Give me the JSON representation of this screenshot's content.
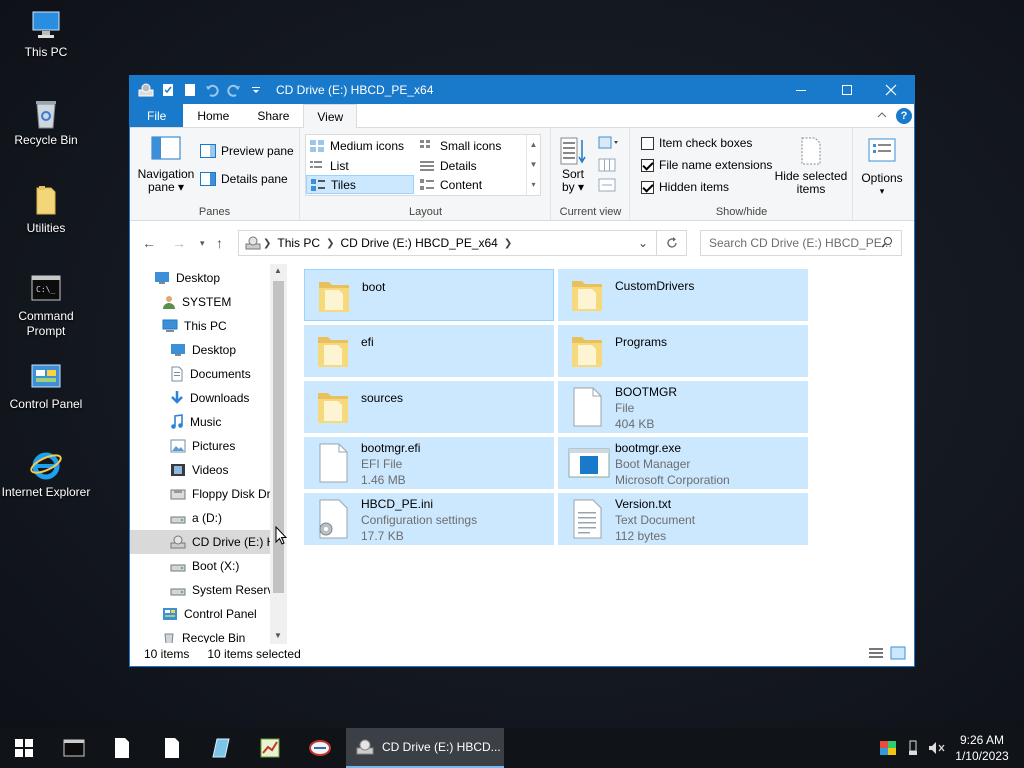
{
  "desktop": {
    "icons": [
      {
        "label": "This PC",
        "icon": "computer-icon"
      },
      {
        "label": "Recycle Bin",
        "icon": "recycle-bin-icon"
      },
      {
        "label": "Utilities",
        "icon": "folder-icon"
      },
      {
        "label": "Command Prompt",
        "icon": "command-prompt-icon"
      },
      {
        "label": "Control Panel",
        "icon": "control-panel-icon"
      },
      {
        "label": "Internet Explorer",
        "icon": "internet-explorer-icon"
      }
    ]
  },
  "window": {
    "title": "CD Drive (E:) HBCD_PE_x64",
    "ribbon_tabs": [
      "File",
      "Home",
      "Share",
      "View"
    ],
    "active_tab": "View",
    "ribbon": {
      "panes": {
        "navigation_pane_line1": "Navigation",
        "navigation_pane_line2": "pane",
        "preview_pane": "Preview pane",
        "details_pane": "Details pane",
        "label": "Panes"
      },
      "layout": {
        "options": [
          "Medium icons",
          "Small icons",
          "List",
          "Details",
          "Tiles",
          "Content"
        ],
        "selected": "Tiles",
        "label": "Layout"
      },
      "current_view": {
        "sort_line1": "Sort",
        "sort_line2": "by",
        "label": "Current view"
      },
      "show_hide": {
        "item_check_boxes": "Item check boxes",
        "file_name_extensions": "File name extensions",
        "hidden_items": "Hidden items",
        "item_check_boxes_checked": false,
        "file_name_extensions_checked": true,
        "hidden_items_checked": true,
        "hide_selected_line1": "Hide selected",
        "hide_selected_line2": "items",
        "label": "Show/hide"
      },
      "options_label": "Options"
    },
    "address": {
      "crumbs": [
        "This PC",
        "CD Drive (E:) HBCD_PE_x64"
      ],
      "search_placeholder": "Search CD Drive (E:) HBCD_PE..."
    },
    "nav_pane": [
      {
        "label": "Desktop",
        "icon": "desktop-icon"
      },
      {
        "label": "SYSTEM",
        "icon": "user-icon"
      },
      {
        "label": "This PC",
        "icon": "computer-icon"
      },
      {
        "label": "Desktop",
        "icon": "desktop-icon"
      },
      {
        "label": "Documents",
        "icon": "documents-icon"
      },
      {
        "label": "Downloads",
        "icon": "downloads-icon"
      },
      {
        "label": "Music",
        "icon": "music-icon"
      },
      {
        "label": "Pictures",
        "icon": "pictures-icon"
      },
      {
        "label": "Videos",
        "icon": "videos-icon"
      },
      {
        "label": "Floppy Disk Dri",
        "icon": "floppy-icon"
      },
      {
        "label": "a (D:)",
        "icon": "drive-icon"
      },
      {
        "label": "CD Drive (E:) H",
        "icon": "cd-drive-icon"
      },
      {
        "label": "Boot (X:)",
        "icon": "drive-icon"
      },
      {
        "label": "System Reserve",
        "icon": "drive-icon"
      },
      {
        "label": "Control Panel",
        "icon": "control-panel-icon"
      },
      {
        "label": "Recycle Bin",
        "icon": "recycle-bin-icon"
      }
    ],
    "items": [
      {
        "name": "boot",
        "type": "folder"
      },
      {
        "name": "CustomDrivers",
        "type": "folder"
      },
      {
        "name": "efi",
        "type": "folder"
      },
      {
        "name": "Programs",
        "type": "folder"
      },
      {
        "name": "sources",
        "type": "folder"
      },
      {
        "name": "BOOTMGR",
        "type": "file",
        "line1": "File",
        "line2": "404 KB"
      },
      {
        "name": "bootmgr.efi",
        "type": "file",
        "line1": "EFI File",
        "line2": "1.46 MB"
      },
      {
        "name": "bootmgr.exe",
        "type": "exe",
        "line1": "Boot Manager",
        "line2": "Microsoft Corporation"
      },
      {
        "name": "HBCD_PE.ini",
        "type": "ini",
        "line1": "Configuration settings",
        "line2": "17.7 KB"
      },
      {
        "name": "Version.txt",
        "type": "txt",
        "line1": "Text Document",
        "line2": "112 bytes"
      }
    ],
    "status": {
      "count": "10 items",
      "selected": "10 items selected"
    }
  },
  "taskbar": {
    "task_label": "CD Drive (E:) HBCD...",
    "time": "9:26 AM",
    "date": "1/10/2023"
  },
  "colors": {
    "accent": "#1979ca",
    "selection": "#cce8ff",
    "selection_border": "#99d1ff",
    "folder": "#f3d57a"
  }
}
